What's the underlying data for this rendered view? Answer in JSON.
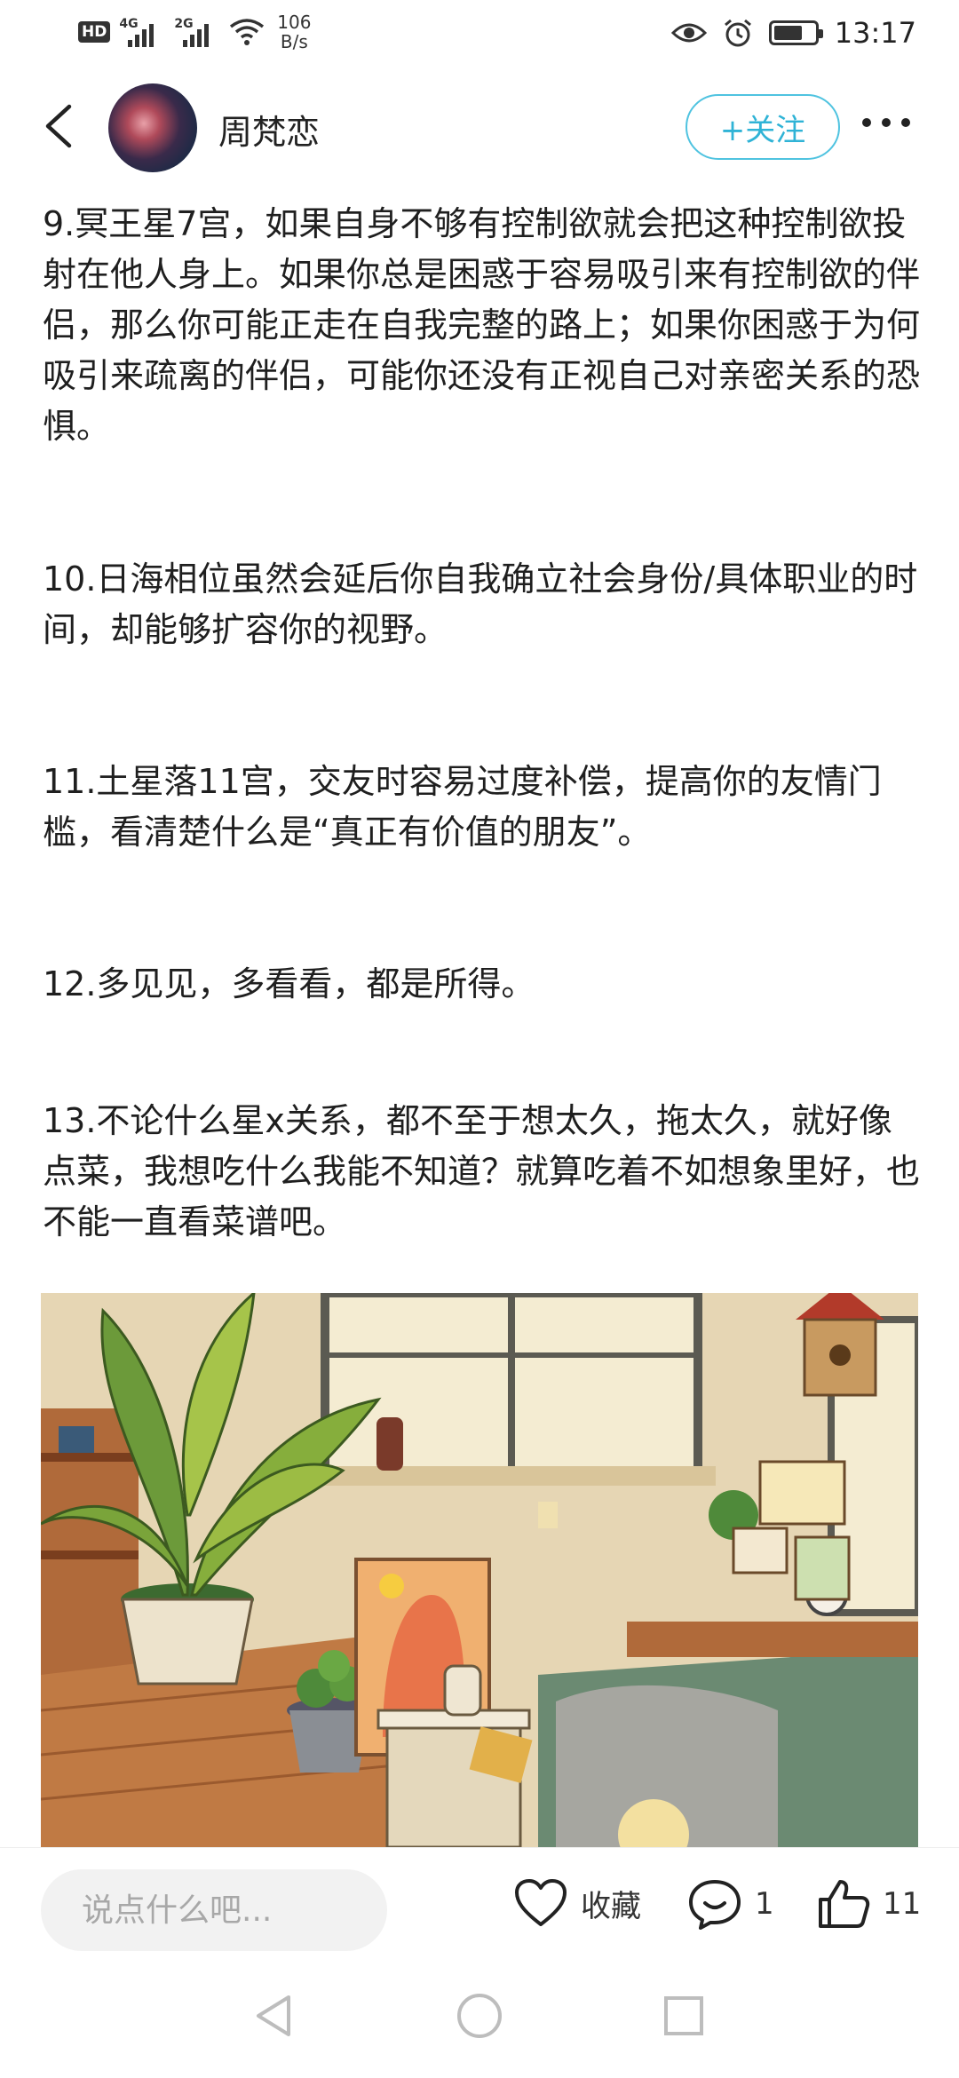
{
  "status_bar": {
    "hd_badge": "HD",
    "sim1_net": "4G",
    "sim2_net": "2G",
    "net_speed_value": "106",
    "net_speed_unit": "B/s",
    "time": "13:17",
    "battery_level": 0.7,
    "icons": [
      "hd-icon",
      "signal-icon",
      "wifi-icon",
      "eye-icon",
      "alarm-icon",
      "battery-icon"
    ]
  },
  "header": {
    "username": "周梵恋",
    "follow_label": "+关注",
    "accent_color": "#2fb3d6"
  },
  "article": {
    "paragraphs": [
      "9.冥王星7宫，如果自身不够有控制欲就会把这种控制欲投射在他人身上。如果你总是困惑于容易吸引来有控制欲的伴侣，那么你可能正走在自我完整的路上；如果你困惑于为何吸引来疏离的伴侣，可能你还没有正视自己对亲密关系的恐惧。",
      "10.日海相位虽然会延后你自我确立社会身份/具体职业的时间，却能够扩容你的视野。",
      "11.土星落11宫，交友时容易过度补偿，提高你的友情门槛，看清楚什么是“真正有价值的朋友”。",
      "12.多见见，多看看，都是所得。",
      "13.不论什么星x关系，都不至于想太久，拖太久，就好像点菜，我想吃什么我能不知道？就算吃着不如想象里好，也不能一直看菜谱吧。"
    ]
  },
  "bottom_bar": {
    "comment_placeholder": "说点什么吧...",
    "favorite_label": "收藏",
    "comment_count": "1",
    "like_count": "11"
  }
}
